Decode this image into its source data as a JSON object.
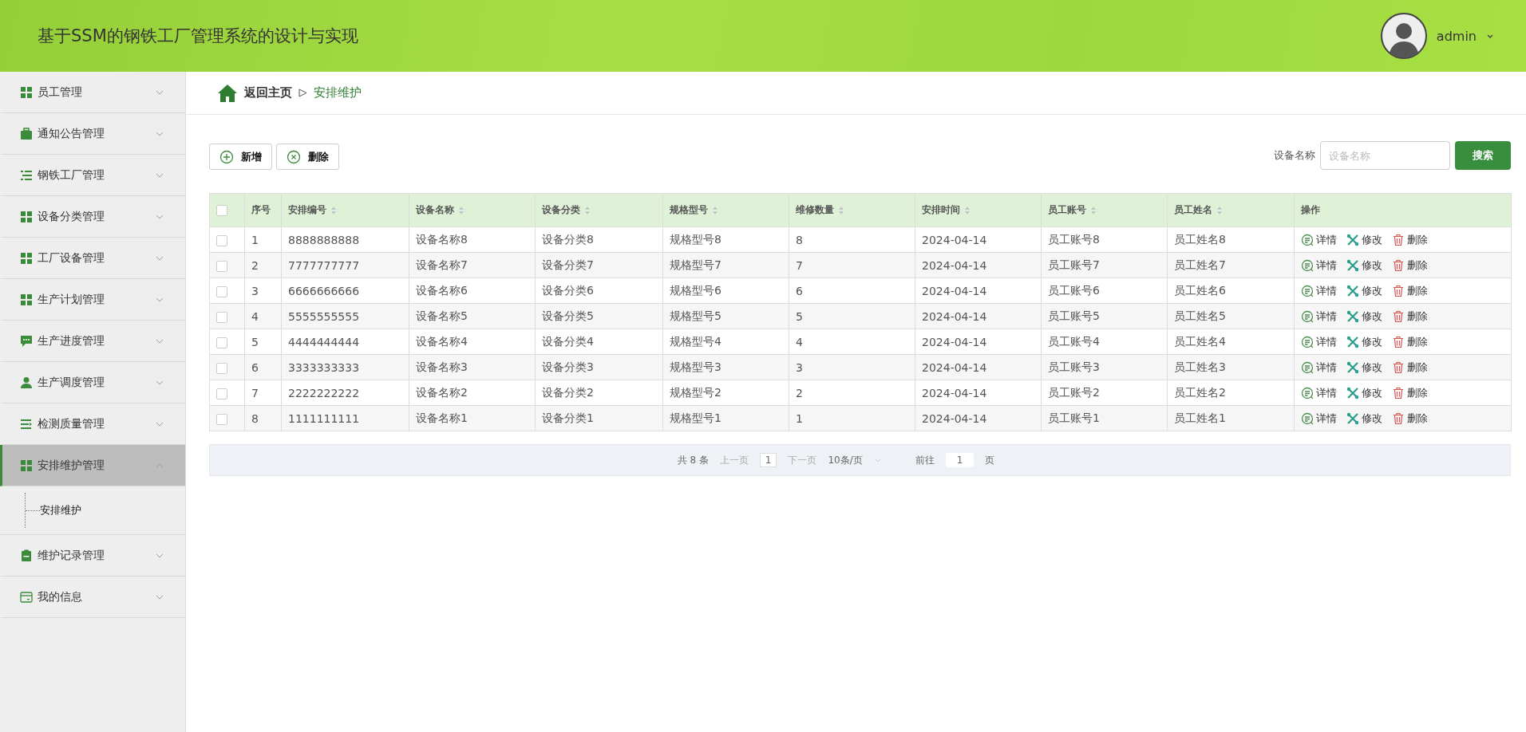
{
  "header": {
    "title": "基于SSM的钢铁工厂管理系统的设计与实现",
    "user": "admin"
  },
  "sidebar": {
    "items": [
      {
        "label": "员工管理",
        "kind": "grid",
        "expanded": false,
        "selected": false
      },
      {
        "label": "通知公告管理",
        "kind": "briefcase",
        "expanded": false,
        "selected": false
      },
      {
        "label": "钢铁工厂管理",
        "kind": "list",
        "expanded": false,
        "selected": false
      },
      {
        "label": "设备分类管理",
        "kind": "grid",
        "expanded": false,
        "selected": false
      },
      {
        "label": "工厂设备管理",
        "kind": "grid",
        "expanded": false,
        "selected": false
      },
      {
        "label": "生产计划管理",
        "kind": "grid",
        "expanded": false,
        "selected": false
      },
      {
        "label": "生产进度管理",
        "kind": "chat",
        "expanded": false,
        "selected": false
      },
      {
        "label": "生产调度管理",
        "kind": "person",
        "expanded": false,
        "selected": false
      },
      {
        "label": "检测质量管理",
        "kind": "lines",
        "expanded": false,
        "selected": false
      },
      {
        "label": "安排维护管理",
        "kind": "grid",
        "expanded": true,
        "selected": true,
        "children": [
          {
            "label": "安排维护"
          }
        ]
      },
      {
        "label": "维护记录管理",
        "kind": "clipboard",
        "expanded": false,
        "selected": false
      },
      {
        "label": "我的信息",
        "kind": "card",
        "expanded": false,
        "selected": false
      }
    ]
  },
  "breadcrumb": {
    "home": "返回主页",
    "current": "安排维护"
  },
  "toolbar": {
    "buttons": [
      {
        "label": "新增",
        "kind": "add"
      },
      {
        "label": "删除",
        "kind": "delete"
      }
    ],
    "search": {
      "label": "设备名称",
      "placeholder": "设备名称",
      "button": "搜索"
    }
  },
  "table": {
    "all_checked": false,
    "columns": [
      {
        "label": "序号",
        "sortable": false
      },
      {
        "label": "安排编号",
        "sortable": true
      },
      {
        "label": "设备名称",
        "sortable": true
      },
      {
        "label": "设备分类",
        "sortable": true
      },
      {
        "label": "规格型号",
        "sortable": true
      },
      {
        "label": "维修数量",
        "sortable": true
      },
      {
        "label": "安排时间",
        "sortable": true
      },
      {
        "label": "员工账号",
        "sortable": true
      },
      {
        "label": "员工姓名",
        "sortable": true
      },
      {
        "label": "操作",
        "sortable": false
      }
    ],
    "rows": [
      {
        "checked": false,
        "cells": [
          "1",
          "8888888888",
          "设备名称8",
          "设备分类8",
          "规格型号8",
          "8",
          "2024-04-14",
          "员工账号8",
          "员工姓名8"
        ],
        "actions": [
          {
            "label": "详情",
            "kind": "detail"
          },
          {
            "label": "修改",
            "kind": "edit"
          },
          {
            "label": "删除",
            "kind": "delete"
          }
        ]
      },
      {
        "checked": false,
        "cells": [
          "2",
          "7777777777",
          "设备名称7",
          "设备分类7",
          "规格型号7",
          "7",
          "2024-04-14",
          "员工账号7",
          "员工姓名7"
        ],
        "actions": [
          {
            "label": "详情",
            "kind": "detail"
          },
          {
            "label": "修改",
            "kind": "edit"
          },
          {
            "label": "删除",
            "kind": "delete"
          }
        ]
      },
      {
        "checked": false,
        "cells": [
          "3",
          "6666666666",
          "设备名称6",
          "设备分类6",
          "规格型号6",
          "6",
          "2024-04-14",
          "员工账号6",
          "员工姓名6"
        ],
        "actions": [
          {
            "label": "详情",
            "kind": "detail"
          },
          {
            "label": "修改",
            "kind": "edit"
          },
          {
            "label": "删除",
            "kind": "delete"
          }
        ]
      },
      {
        "checked": false,
        "cells": [
          "4",
          "5555555555",
          "设备名称5",
          "设备分类5",
          "规格型号5",
          "5",
          "2024-04-14",
          "员工账号5",
          "员工姓名5"
        ],
        "actions": [
          {
            "label": "详情",
            "kind": "detail"
          },
          {
            "label": "修改",
            "kind": "edit"
          },
          {
            "label": "删除",
            "kind": "delete"
          }
        ]
      },
      {
        "checked": false,
        "cells": [
          "5",
          "4444444444",
          "设备名称4",
          "设备分类4",
          "规格型号4",
          "4",
          "2024-04-14",
          "员工账号4",
          "员工姓名4"
        ],
        "actions": [
          {
            "label": "详情",
            "kind": "detail"
          },
          {
            "label": "修改",
            "kind": "edit"
          },
          {
            "label": "删除",
            "kind": "delete"
          }
        ]
      },
      {
        "checked": false,
        "cells": [
          "6",
          "3333333333",
          "设备名称3",
          "设备分类3",
          "规格型号3",
          "3",
          "2024-04-14",
          "员工账号3",
          "员工姓名3"
        ],
        "actions": [
          {
            "label": "详情",
            "kind": "detail"
          },
          {
            "label": "修改",
            "kind": "edit"
          },
          {
            "label": "删除",
            "kind": "delete"
          }
        ]
      },
      {
        "checked": false,
        "cells": [
          "7",
          "2222222222",
          "设备名称2",
          "设备分类2",
          "规格型号2",
          "2",
          "2024-04-14",
          "员工账号2",
          "员工姓名2"
        ],
        "actions": [
          {
            "label": "详情",
            "kind": "detail"
          },
          {
            "label": "修改",
            "kind": "edit"
          },
          {
            "label": "删除",
            "kind": "delete"
          }
        ]
      },
      {
        "checked": false,
        "cells": [
          "8",
          "1111111111",
          "设备名称1",
          "设备分类1",
          "规格型号1",
          "1",
          "2024-04-14",
          "员工账号1",
          "员工姓名1"
        ],
        "actions": [
          {
            "label": "详情",
            "kind": "detail"
          },
          {
            "label": "修改",
            "kind": "edit"
          },
          {
            "label": "删除",
            "kind": "delete"
          }
        ]
      }
    ]
  },
  "pagination": {
    "total": "共 8 条",
    "prev": "上一页",
    "page": "1",
    "next": "下一页",
    "page_size": "10条/页",
    "goto": "前往",
    "goto_value": "1",
    "page_unit": "页"
  }
}
